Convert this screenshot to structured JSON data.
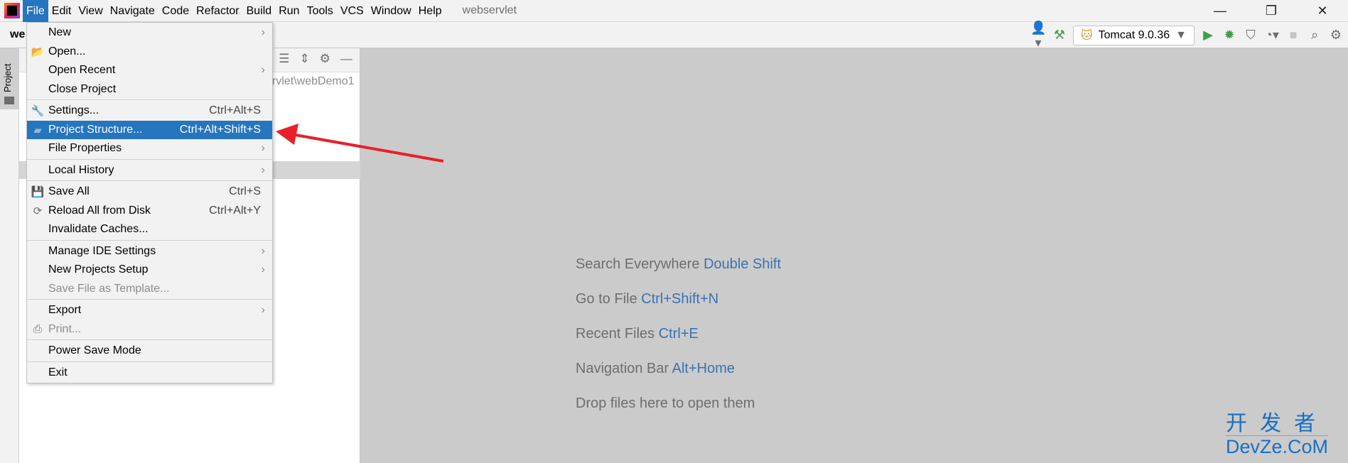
{
  "menubar": {
    "items": [
      "File",
      "Edit",
      "View",
      "Navigate",
      "Code",
      "Refactor",
      "Build",
      "Run",
      "Tools",
      "VCS",
      "Window",
      "Help"
    ],
    "active": "File",
    "title": "webservlet"
  },
  "toolbar": {
    "project_name": "we",
    "run_config": "Tomcat 9.0.36"
  },
  "sidebar": {
    "project_tab": "Project"
  },
  "panel": {
    "path_fragment": "rvlet\\webDemo1"
  },
  "file_menu": {
    "items": [
      {
        "label": "New",
        "submenu": true
      },
      {
        "label": "Open...",
        "icon": "folder-open-icon"
      },
      {
        "label": "Open Recent",
        "submenu": true
      },
      {
        "label": "Close Project",
        "sep_after": true
      },
      {
        "label": "Settings...",
        "shortcut": "Ctrl+Alt+S",
        "icon": "wrench-icon"
      },
      {
        "label": "Project Structure...",
        "shortcut": "Ctrl+Alt+Shift+S",
        "icon": "project-structure-icon",
        "highlighted": true
      },
      {
        "label": "File Properties",
        "submenu": true,
        "sep_after": true
      },
      {
        "label": "Local History",
        "submenu": true,
        "sep_after": true
      },
      {
        "label": "Save All",
        "shortcut": "Ctrl+S",
        "icon": "save-icon"
      },
      {
        "label": "Reload All from Disk",
        "shortcut": "Ctrl+Alt+Y",
        "icon": "reload-icon"
      },
      {
        "label": "Invalidate Caches...",
        "sep_after": true
      },
      {
        "label": "Manage IDE Settings",
        "submenu": true
      },
      {
        "label": "New Projects Setup",
        "submenu": true
      },
      {
        "label": "Save File as Template...",
        "disabled": true,
        "sep_after": true
      },
      {
        "label": "Export",
        "submenu": true
      },
      {
        "label": "Print...",
        "disabled": true,
        "icon": "printer-icon",
        "sep_after": true
      },
      {
        "label": "Power Save Mode",
        "sep_after": true
      },
      {
        "label": "Exit"
      }
    ]
  },
  "welcome": [
    {
      "text": "Search Everywhere",
      "key": "Double Shift"
    },
    {
      "text": "Go to File",
      "key": "Ctrl+Shift+N"
    },
    {
      "text": "Recent Files",
      "key": "Ctrl+E"
    },
    {
      "text": "Navigation Bar",
      "key": "Alt+Home"
    },
    {
      "text": "Drop files here to open them",
      "key": ""
    }
  ],
  "watermark": {
    "cn": "开发者",
    "en": "DevZe.CoM"
  },
  "colors": {
    "accent": "#2675bf",
    "annotation_arrow": "#e8202a",
    "shortcut_blue": "#3a72b0"
  }
}
